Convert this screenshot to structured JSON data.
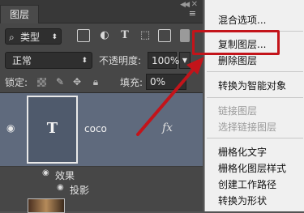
{
  "panel": {
    "tab_label": "图层",
    "collapse_glyph": "◀◀",
    "close_glyph": "✕",
    "menu_glyph": "≡"
  },
  "filter": {
    "search_glyph": "⌕",
    "kind_label": "类型",
    "arrow": "⬍"
  },
  "blend": {
    "mode": "正常",
    "arrow": "⬍",
    "opacity_label": "不透明度:",
    "opacity_value": "100%",
    "opacity_arrow": "▼"
  },
  "lock": {
    "label": "锁定:",
    "fill_label": "填充:",
    "fill_value": "0%"
  },
  "layer": {
    "name": "coco",
    "thumb_letter": "T",
    "fx": "fx",
    "effects_label": "效果",
    "shadow_label": "投影"
  },
  "menu": {
    "items": [
      {
        "label": "混合选项...",
        "disabled": false
      },
      {
        "label": "复制图层...",
        "disabled": false
      },
      {
        "label": "删除图层",
        "disabled": false
      },
      {
        "label": "转换为智能对象",
        "disabled": false
      },
      {
        "label": "链接图层",
        "disabled": true
      },
      {
        "label": "选择链接图层",
        "disabled": true
      },
      {
        "label": "栅格化文字",
        "disabled": false
      },
      {
        "label": "栅格化图层样式",
        "disabled": false
      },
      {
        "label": "创建工作路径",
        "disabled": false
      },
      {
        "label": "转换为形状",
        "disabled": false
      }
    ]
  },
  "colors": {
    "highlight": "#c3141a",
    "selected_layer": "#5f6a7d"
  }
}
